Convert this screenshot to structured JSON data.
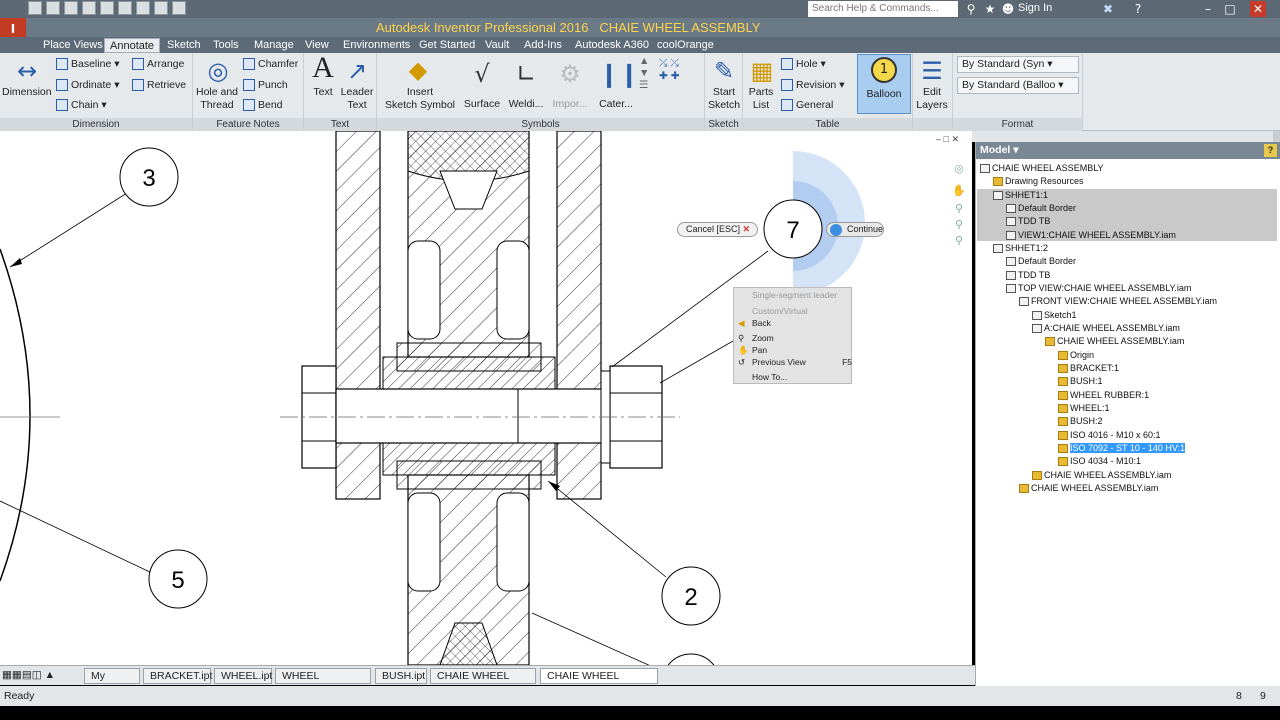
{
  "app": {
    "title": "Autodesk Inventor Professional 2016",
    "document": "CHAIE WHEEL ASSEMBLY",
    "logo_text": "I",
    "search_placeholder": "Search Help & Commands...",
    "sign_in": "Sign In"
  },
  "tabs": [
    "Place Views",
    "Annotate",
    "Sketch",
    "Tools",
    "Manage",
    "View",
    "Environments",
    "Get Started",
    "Vault",
    "Add-Ins",
    "Autodesk A360",
    "coolOrange"
  ],
  "active_tab": "Annotate",
  "ribbon": {
    "dimension": {
      "label": "Dimension",
      "big": "Dimension",
      "baseline": "Baseline",
      "ordinate": "Ordinate",
      "chain": "Chain",
      "arrange": "Arrange",
      "retrieve": "Retrieve"
    },
    "feature_notes": {
      "label": "Feature Notes",
      "hole_thread": [
        "Hole and",
        "Thread"
      ],
      "chamfer": "Chamfer",
      "punch": "Punch",
      "bend": "Bend"
    },
    "text": {
      "label": "Text",
      "text": "Text",
      "leader_text": [
        "Leader",
        "Text"
      ]
    },
    "symbols": {
      "label": "Symbols",
      "insert_symbol": [
        "Insert",
        "Sketch Symbol"
      ],
      "surface": "Surface",
      "welding": "Weldi...",
      "import": "Impor...",
      "caterpillar": "Cater..."
    },
    "sketch": {
      "label": "Sketch",
      "start_sketch": [
        "Start",
        "Sketch"
      ]
    },
    "table": {
      "label": "Table",
      "parts_list": [
        "Parts",
        "List"
      ],
      "hole": "Hole",
      "revision": "Revision",
      "general": "General",
      "balloon": "Balloon",
      "balloon_num": "1"
    },
    "layers": {
      "edit_layers": [
        "Edit",
        "Layers"
      ]
    },
    "format": {
      "label": "Format",
      "style1": "By Standard (Syn",
      "style2": "By Standard (Balloo"
    }
  },
  "drawing": {
    "balloons": [
      "3",
      "5",
      "2",
      "7"
    ]
  },
  "overlay": {
    "cancel": "Cancel [ESC]",
    "continue": "Continue"
  },
  "context_menu": {
    "items": [
      {
        "label": "Single-segment leader",
        "disabled": true
      },
      {
        "label": "Custom/Virtual",
        "disabled": true
      },
      {
        "label": "Back",
        "disabled": false
      },
      {
        "label": "Zoom",
        "disabled": false
      },
      {
        "label": "Pan",
        "disabled": false
      },
      {
        "label": "Previous View",
        "disabled": false,
        "shortcut": "F5"
      },
      {
        "label": "How To...",
        "disabled": false
      }
    ]
  },
  "browser": {
    "title": "Model",
    "help": "?",
    "tree": [
      {
        "label": "CHAIE WHEEL ASSEMBLY",
        "icon": "drawing",
        "depth": 0
      },
      {
        "label": "Drawing Resources",
        "icon": "folder",
        "depth": 1
      },
      {
        "label": "SHHET1:1",
        "icon": "sheet",
        "depth": 1
      },
      {
        "label": "Default Border",
        "icon": "sheet",
        "depth": 2
      },
      {
        "label": "TDD TB",
        "icon": "sheet",
        "depth": 2
      },
      {
        "label": "VIEW1:CHAIE WHEEL ASSEMBLY.iam",
        "icon": "view",
        "depth": 2
      },
      {
        "label": "SHHET1:2",
        "icon": "sheet",
        "depth": 1
      },
      {
        "label": "Default Border",
        "icon": "sheet",
        "depth": 2
      },
      {
        "label": "TDD TB",
        "icon": "sheet",
        "depth": 2
      },
      {
        "label": "TOP VIEW:CHAIE WHEEL ASSEMBLY.iam",
        "icon": "view",
        "depth": 2
      },
      {
        "label": "FRONT VIEW:CHAIE WHEEL ASSEMBLY.iam",
        "icon": "view",
        "depth": 3
      },
      {
        "label": "Sketch1",
        "icon": "sketch",
        "depth": 4
      },
      {
        "label": "A:CHAIE WHEEL ASSEMBLY.iam",
        "icon": "view",
        "depth": 4
      },
      {
        "label": "CHAIE WHEEL ASSEMBLY.iam",
        "icon": "part",
        "depth": 5
      },
      {
        "label": "Origin",
        "icon": "folder",
        "depth": 6
      },
      {
        "label": "BRACKET:1",
        "icon": "part",
        "depth": 6
      },
      {
        "label": "BUSH:1",
        "icon": "part",
        "depth": 6
      },
      {
        "label": "WHEEL RUBBER:1",
        "icon": "part",
        "depth": 6
      },
      {
        "label": "WHEEL:1",
        "icon": "part",
        "depth": 6
      },
      {
        "label": "BUSH:2",
        "icon": "part",
        "depth": 6
      },
      {
        "label": "ISO 4016 - M10 x 60:1",
        "icon": "part",
        "depth": 6
      },
      {
        "label": "ISO 7092 - ST 10 - 140 HV:1",
        "icon": "part",
        "depth": 6,
        "selected": true
      },
      {
        "label": "ISO 4034 - M10:1",
        "icon": "part",
        "depth": 6
      },
      {
        "label": "CHAIE WHEEL ASSEMBLY.iam",
        "icon": "part",
        "depth": 4
      },
      {
        "label": "CHAIE WHEEL ASSEMBLY.iam",
        "icon": "part",
        "depth": 3
      }
    ]
  },
  "doc_tabs": [
    "My Home",
    "BRACKET.ipt",
    "WHEEL.ipt",
    "WHEEL RUBBER.ipt",
    "BUSH.ipt",
    "CHAIE WHEEL A....iam",
    "CHAIE WHEEL ASSE..."
  ],
  "active_doc_tab": "CHAIE WHEEL ASSE...",
  "status": {
    "text": "Ready",
    "n1": "8",
    "n2": "9"
  },
  "colors": {
    "accent": "#3399ff",
    "title_text": "#ffd24a",
    "chrome": "#6b7a87"
  }
}
